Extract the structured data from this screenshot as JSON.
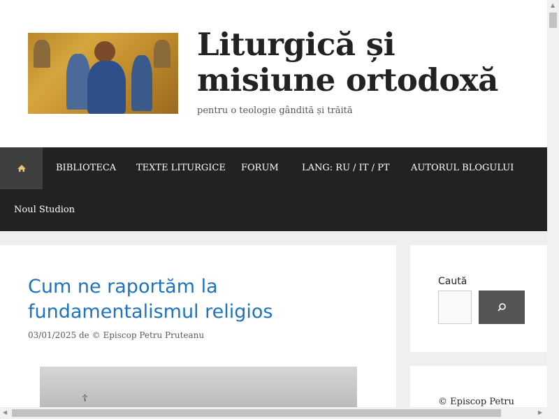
{
  "header": {
    "title": "Liturgică și misiune ortodoxă",
    "description": "pentru o teologie gândită și trăită"
  },
  "nav": {
    "home_icon": "home-icon",
    "items": [
      {
        "label": "BIBLIOTECA"
      },
      {
        "label": "TEXTE LITURGICE"
      },
      {
        "label": "FORUM"
      },
      {
        "label": "LANG: RU / IT / PT"
      },
      {
        "label": "AUTORUL BLOGULUI"
      },
      {
        "label": "Noul Studion"
      }
    ]
  },
  "post": {
    "title": "Cum ne raportăm la fundamentalismul religios",
    "date": "03/01/2025",
    "by": "de",
    "author": "© Episcop Petru Pruteanu"
  },
  "sidebar": {
    "search_label": "Caută",
    "search_placeholder": "",
    "widget2_text": "© Episcop Petru"
  },
  "colors": {
    "accent": "#1e73be",
    "nav_bg": "#222222",
    "search_button": "#555555"
  }
}
